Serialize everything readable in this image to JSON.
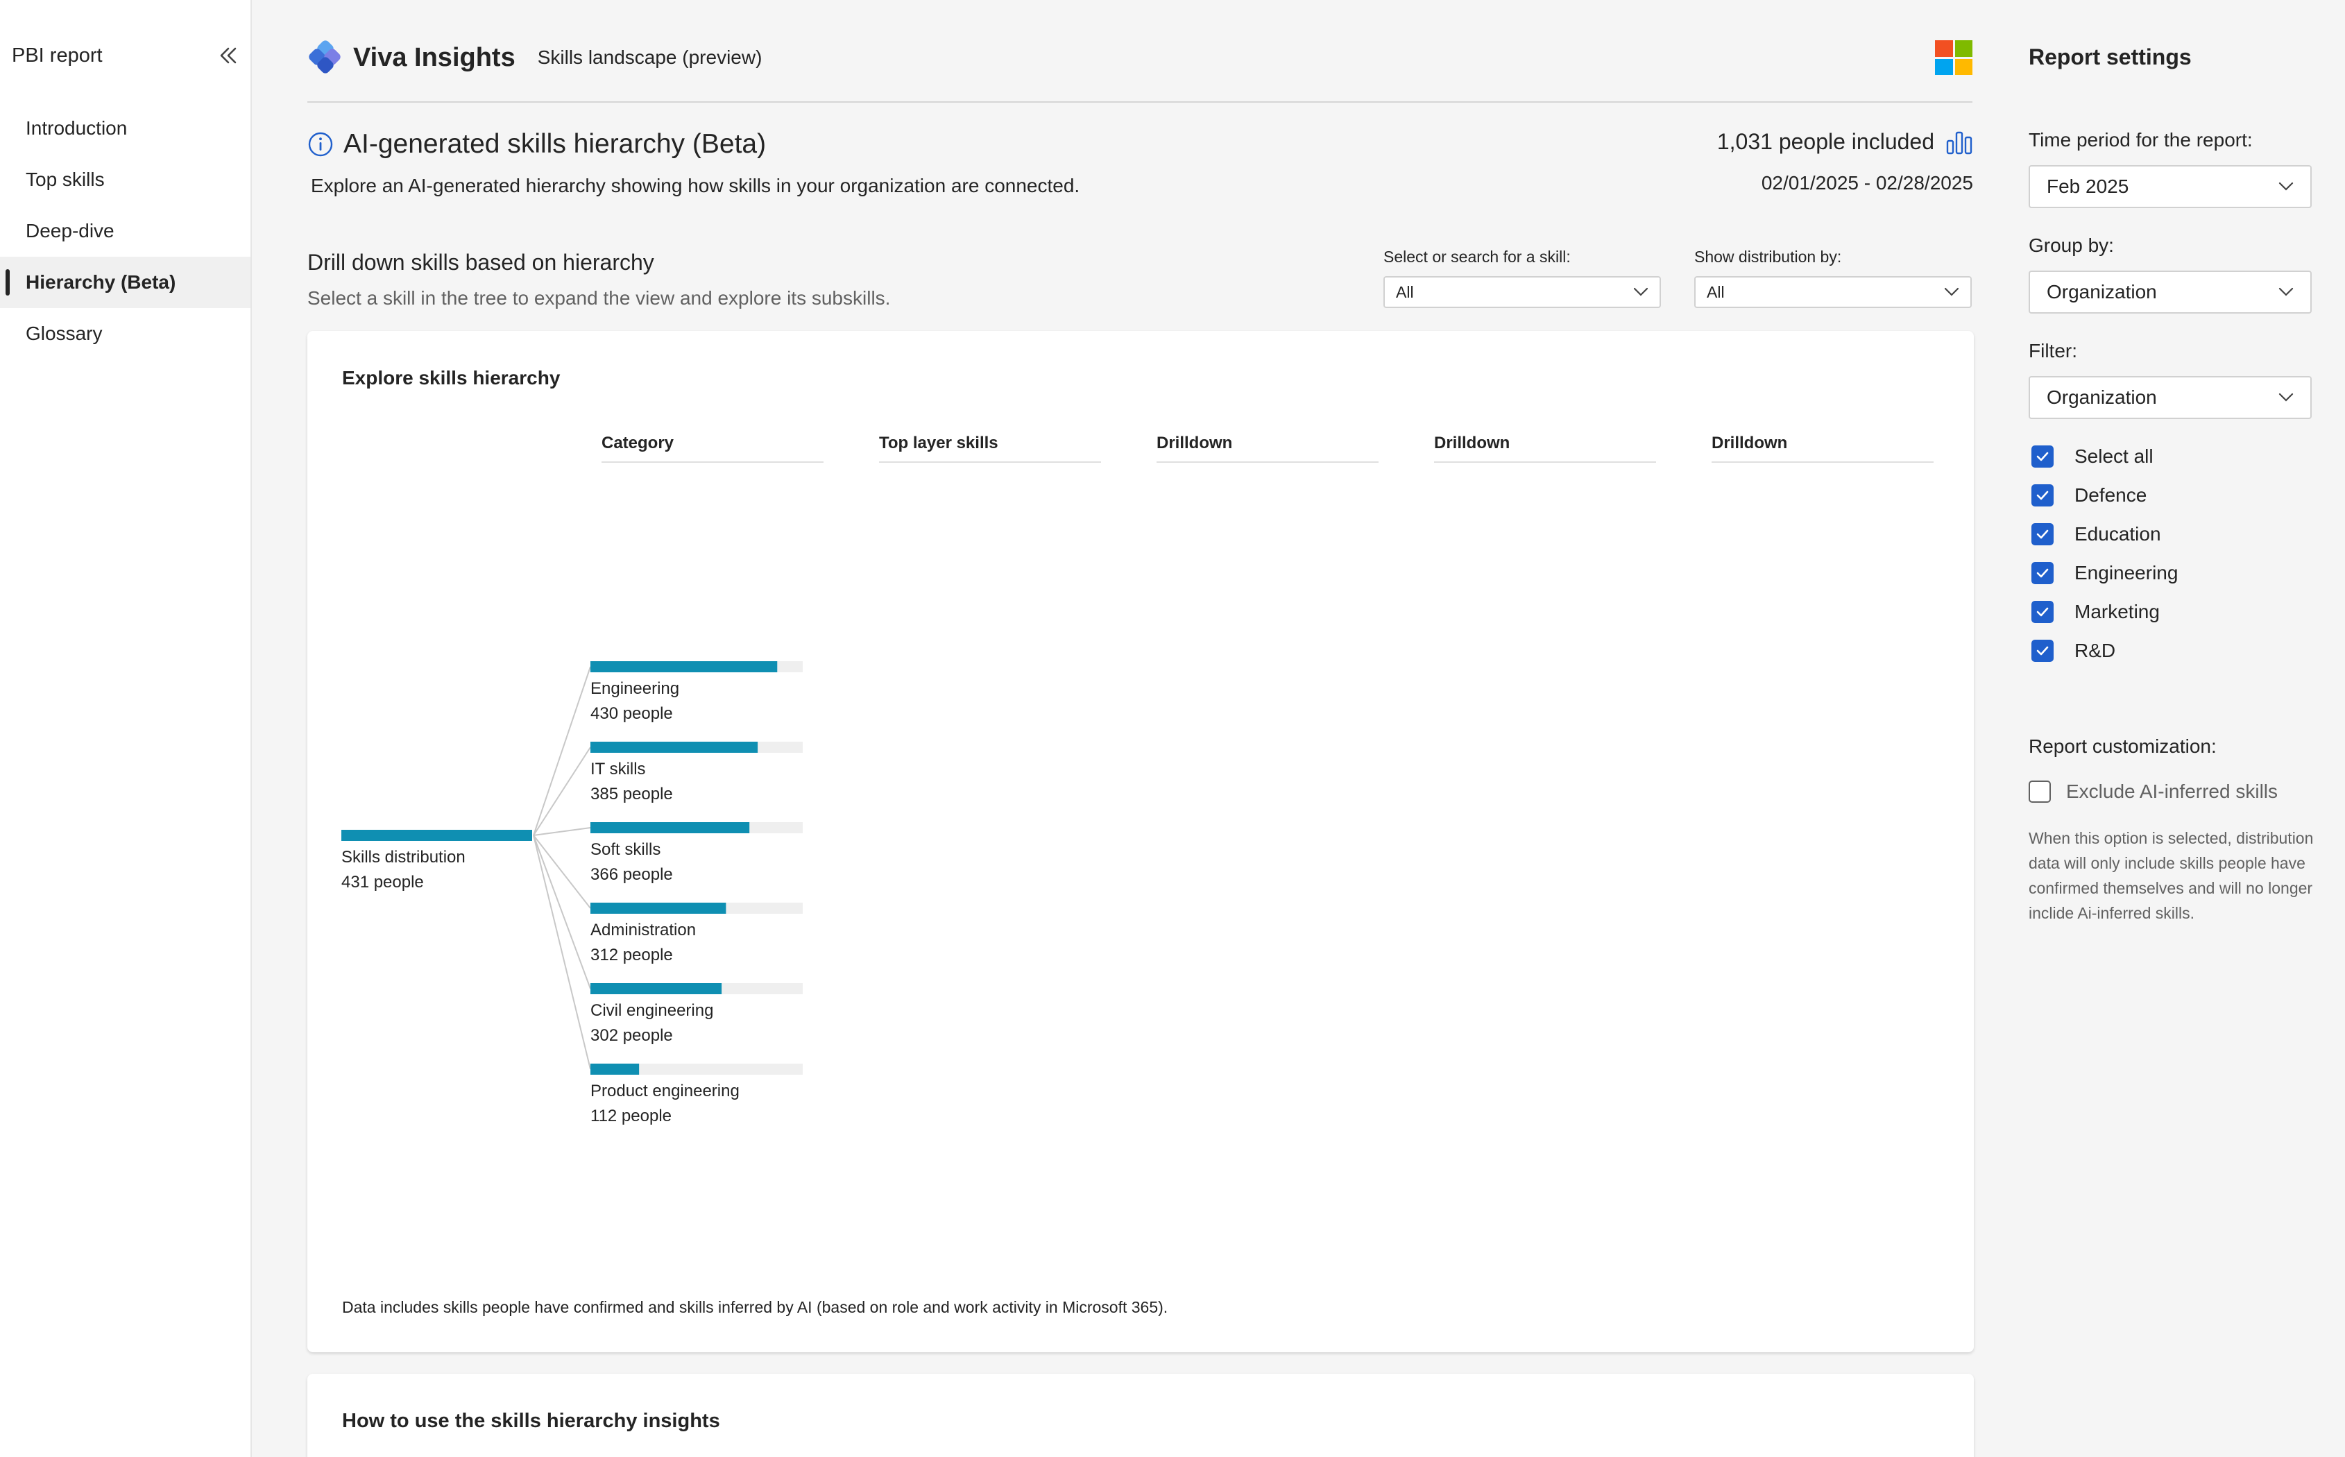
{
  "nav": {
    "title": "PBI report",
    "items": [
      {
        "label": "Introduction",
        "active": false
      },
      {
        "label": "Top skills",
        "active": false
      },
      {
        "label": "Deep-dive",
        "active": false
      },
      {
        "label": "Hierarchy (Beta)",
        "active": true
      },
      {
        "label": "Glossary",
        "active": false
      }
    ]
  },
  "header": {
    "brand": "Viva Insights",
    "subtitle": "Skills landscape (preview)"
  },
  "page": {
    "title": "AI-generated skills hierarchy (Beta)",
    "description": "Explore an AI-generated hierarchy showing how skills in your organization are connected.",
    "people_count": "1,031 people included",
    "date_range": "02/01/2025 - 02/28/2025"
  },
  "drill": {
    "title": "Drill down skills based on hierarchy",
    "description": "Select a skill in the tree to expand the view and explore its subskills.",
    "skill_select": {
      "label": "Select or search for a skill:",
      "value": "All"
    },
    "distribution_select": {
      "label": "Show distribution by:",
      "value": "All"
    }
  },
  "explore": {
    "title": "Explore skills hierarchy",
    "columns": [
      "Category",
      "Top layer skills",
      "Drilldown",
      "Drilldown",
      "Drilldown"
    ],
    "footnote": "Data includes skills people have confirmed and skills inferred by AI (based on role and work activity in Microsoft 365)."
  },
  "chart_data": {
    "type": "bar",
    "root": {
      "name": "Skills distribution",
      "label": "431 people",
      "value": 431
    },
    "categories": [
      "Engineering",
      "IT skills",
      "Soft skills",
      "Administration",
      "Civil engineering",
      "Product engineering"
    ],
    "values": [
      430,
      385,
      366,
      312,
      302,
      112
    ],
    "value_labels": [
      "430 people",
      "385 people",
      "366 people",
      "312 people",
      "302 people",
      "112 people"
    ],
    "bar_color": "#0f8fb2",
    "track_color": "#efefef"
  },
  "howto": {
    "title": "How to use the skills hierarchy insights"
  },
  "settings": {
    "title": "Report settings",
    "time_period": {
      "label": "Time period for the report:",
      "value": "Feb 2025"
    },
    "group_by": {
      "label": "Group by:",
      "value": "Organization"
    },
    "filter": {
      "label": "Filter:",
      "value": "Organization",
      "options": [
        {
          "label": "Select all",
          "checked": true
        },
        {
          "label": "Defence",
          "checked": true
        },
        {
          "label": "Education",
          "checked": true
        },
        {
          "label": "Engineering",
          "checked": true
        },
        {
          "label": "Marketing",
          "checked": true
        },
        {
          "label": "R&D",
          "checked": true
        }
      ]
    },
    "customization": {
      "label": "Report customization:",
      "exclude_label": "Exclude AI-inferred skills",
      "exclude_checked": false,
      "description": "When this option is selected, distribution data will only include skills people have confirmed themselves and will no longer inclide Ai-inferred skills."
    }
  },
  "colors": {
    "accent": "#1f5fcc",
    "bar": "#0f8fb2"
  }
}
